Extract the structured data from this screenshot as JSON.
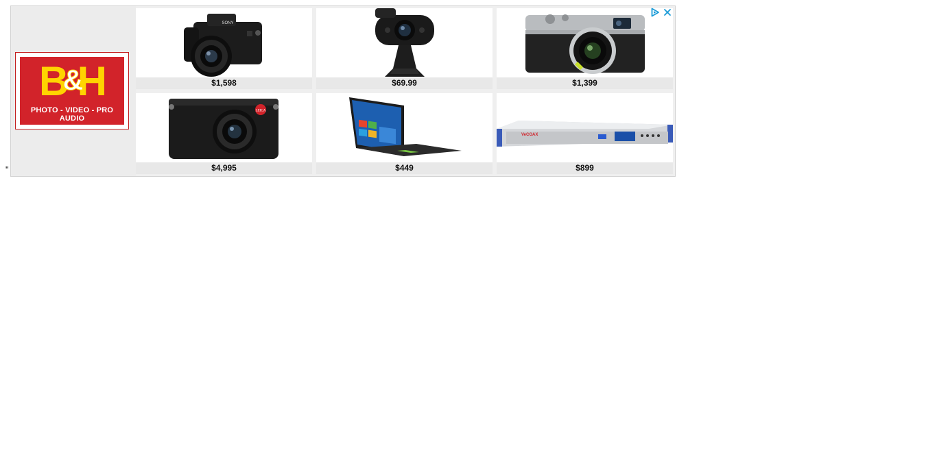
{
  "stray_text": "\"",
  "brand": {
    "logo_text_left": "B",
    "logo_text_amp": "&",
    "logo_text_right": "H",
    "tagline": "PHOTO - VIDEO - PRO AUDIO",
    "colors": {
      "red": "#d2232a",
      "yellow": "#ffd400"
    }
  },
  "ad_controls": {
    "adchoices_icon": "adchoices-play-icon",
    "close_icon": "close-icon",
    "accent": "#1a9bd7"
  },
  "products": [
    {
      "price": "$1,598",
      "image": "mirrorless-camera-sony-image",
      "brand_mark": "SONY"
    },
    {
      "price": "$69.99",
      "image": "webcam-image"
    },
    {
      "price": "$1,399",
      "image": "silver-rangefinder-camera-image"
    },
    {
      "price": "$4,995",
      "image": "leica-compact-camera-image",
      "brand_mark": "LEICA"
    },
    {
      "price": "$449",
      "image": "laptop-image"
    },
    {
      "price": "$899",
      "image": "rackmount-video-processor-image",
      "brand_mark": "VeCOAX"
    }
  ]
}
